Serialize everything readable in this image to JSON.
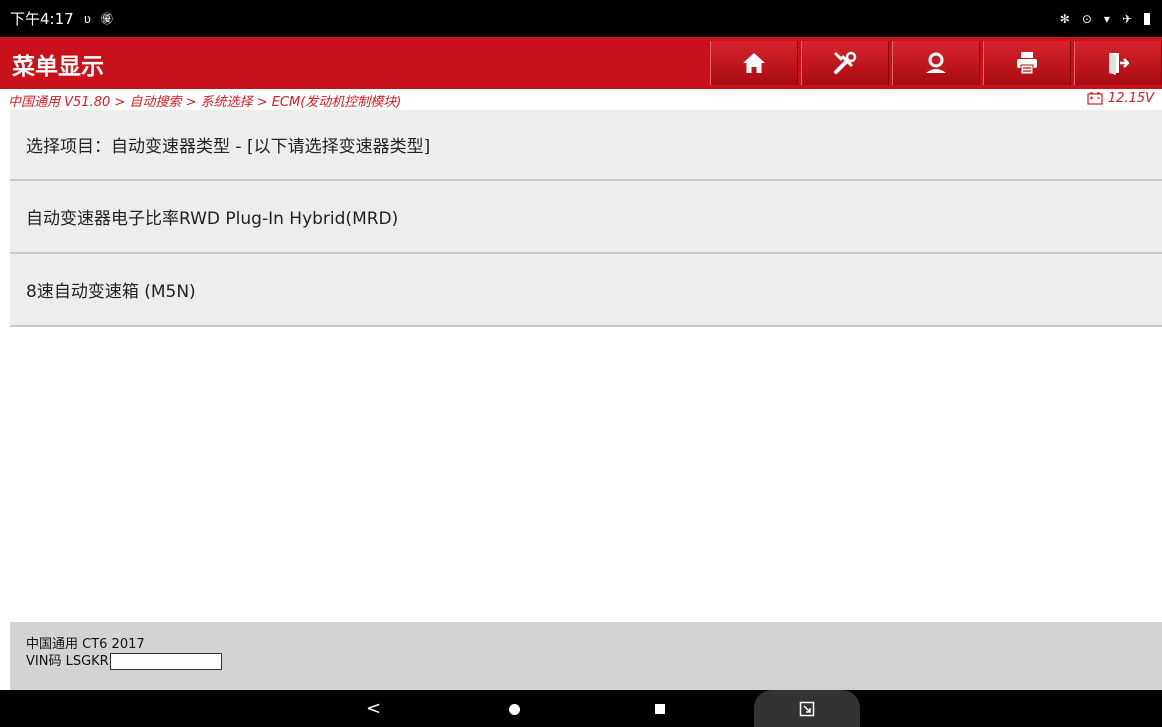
{
  "status_bar": {
    "time": "下午4:17",
    "notification_icons": [
      "vibrate-icon",
      "wechat-icon"
    ],
    "system_icons": [
      "bluetooth-icon",
      "location-icon",
      "wifi-icon",
      "airplane-icon",
      "battery-icon"
    ]
  },
  "header": {
    "title": "菜单显示",
    "toolbar": [
      "home-icon",
      "diagnose-icon",
      "remote-help-icon",
      "print-icon",
      "exit-icon"
    ],
    "accent_color": "#c8111b"
  },
  "breadcrumb": {
    "path": "中国通用 V51.80 > 自动搜索 > 系统选择 > ECM(发动机控制模块)",
    "voltage": "12.15V"
  },
  "menu": {
    "heading": "选择项目：自动变速器类型 - [以下请选择变速器类型]",
    "items": [
      {
        "label": "自动变速器电子比率RWD Plug-In Hybrid(MRD)"
      },
      {
        "label": "8速自动变速箱 (M5N)"
      }
    ]
  },
  "vehicle_info": {
    "model": "中国通用 CT6 2017",
    "vin_label": "VIN码 LSGKR"
  }
}
